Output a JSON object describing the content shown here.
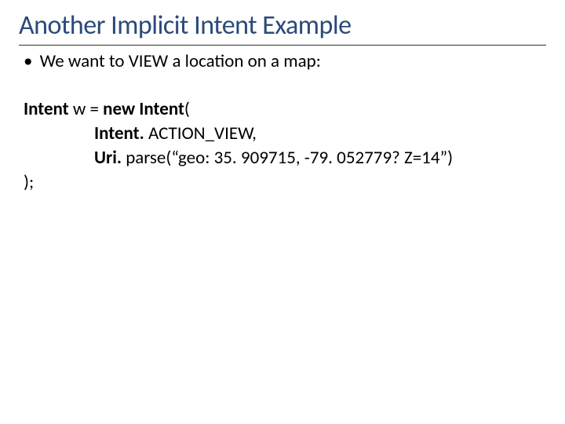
{
  "title": "Another Implicit Intent Example",
  "bullet": {
    "marker": "•",
    "text": "We want to VIEW a location on a map:"
  },
  "code": {
    "line1": {
      "part1_bold": "Intent ",
      "part2": "w = ",
      "part3_bold": "new Intent",
      "part4": "("
    },
    "line2": {
      "part1_bold": "Intent. ",
      "part2": "ACTION_VIEW,"
    },
    "line3": {
      "part1_bold": "Uri. ",
      "part2": "parse(“geo: 35. 909715, -79. 052779? Z=14”)"
    },
    "line4": ");"
  }
}
